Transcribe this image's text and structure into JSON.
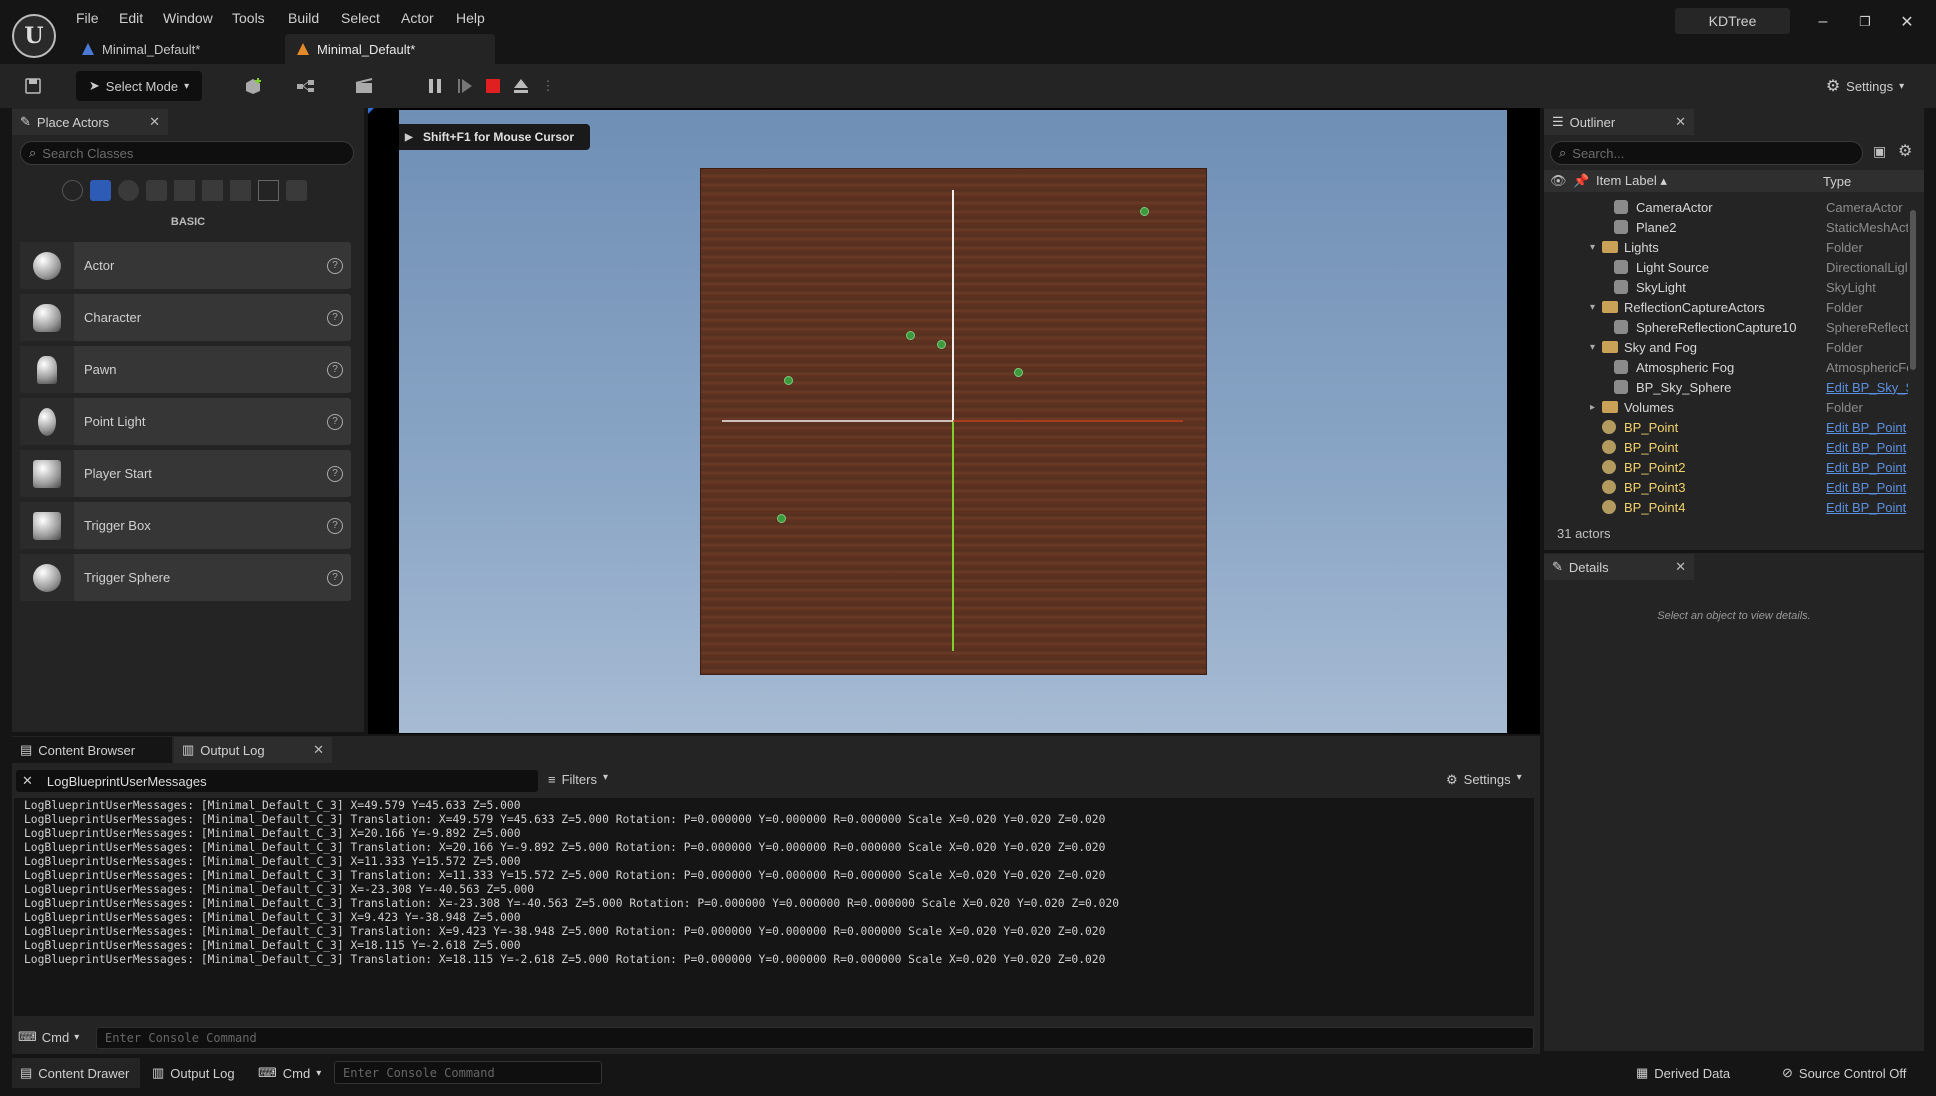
{
  "menu": [
    "File",
    "Edit",
    "Window",
    "Tools",
    "Build",
    "Select",
    "Actor",
    "Help"
  ],
  "project_name": "KDTree",
  "window_buttons": {
    "minimize": "–",
    "restore": "❐",
    "close": "✕"
  },
  "doc_tabs": [
    {
      "label": "Minimal_Default*"
    },
    {
      "label": "Minimal_Default*"
    }
  ],
  "toolbar": {
    "select_mode": "Select Mode",
    "settings": "Settings"
  },
  "place_actors": {
    "tab": "Place Actors",
    "search_placeholder": "Search Classes",
    "category": "BASIC",
    "items": [
      {
        "label": "Actor"
      },
      {
        "label": "Character"
      },
      {
        "label": "Pawn"
      },
      {
        "label": "Point Light"
      },
      {
        "label": "Player Start"
      },
      {
        "label": "Trigger Box"
      },
      {
        "label": "Trigger Sphere"
      }
    ]
  },
  "viewport": {
    "hint": "Shift+F1 for Mouse Cursor",
    "points": [
      {
        "x": 49.579,
        "y": 45.633
      },
      {
        "x": 20.166,
        "y": -9.892
      },
      {
        "x": 11.333,
        "y": 15.572
      },
      {
        "x": -23.308,
        "y": -40.563
      },
      {
        "x": 9.423,
        "y": -38.948
      },
      {
        "x": 18.115,
        "y": -2.618
      }
    ]
  },
  "outliner": {
    "tab": "Outliner",
    "search_placeholder": "Search...",
    "col_label": "Item Label ▴",
    "col_type": "Type",
    "rows": [
      {
        "label": "CameraActor",
        "type": "CameraActor",
        "indent": 2,
        "kind": "gen",
        "link": false
      },
      {
        "label": "Plane2",
        "type": "StaticMeshAct",
        "indent": 2,
        "kind": "gen",
        "link": false
      },
      {
        "label": "Lights",
        "type": "Folder",
        "indent": 1,
        "kind": "folder",
        "link": false
      },
      {
        "label": "Light Source",
        "type": "DirectionalLigl",
        "indent": 2,
        "kind": "gen",
        "link": false
      },
      {
        "label": "SkyLight",
        "type": "SkyLight",
        "indent": 2,
        "kind": "gen",
        "link": false
      },
      {
        "label": "ReflectionCaptureActors",
        "type": "Folder",
        "indent": 1,
        "kind": "folder",
        "link": false
      },
      {
        "label": "SphereReflectionCapture10",
        "type": "SphereReflect",
        "indent": 2,
        "kind": "gen",
        "link": false
      },
      {
        "label": "Sky and Fog",
        "type": "Folder",
        "indent": 1,
        "kind": "folder",
        "link": false
      },
      {
        "label": "Atmospheric Fog",
        "type": "AtmosphericFo",
        "indent": 2,
        "kind": "gen",
        "link": false
      },
      {
        "label": "BP_Sky_Sphere",
        "type": "Edit BP_Sky_S",
        "indent": 2,
        "kind": "gen",
        "link": true
      },
      {
        "label": "Volumes",
        "type": "Folder",
        "indent": 1,
        "kind": "folder",
        "link": false
      },
      {
        "label": "BP_Point",
        "type": "Edit BP_Point",
        "indent": 1,
        "kind": "bp",
        "link": true
      },
      {
        "label": "BP_Point",
        "type": "Edit BP_Point",
        "indent": 1,
        "kind": "bp",
        "link": true
      },
      {
        "label": "BP_Point2",
        "type": "Edit BP_Point",
        "indent": 1,
        "kind": "bp",
        "link": true
      },
      {
        "label": "BP_Point3",
        "type": "Edit BP_Point",
        "indent": 1,
        "kind": "bp",
        "link": true
      },
      {
        "label": "BP_Point4",
        "type": "Edit BP_Point",
        "indent": 1,
        "kind": "bp",
        "link": true
      }
    ],
    "count": "31 actors"
  },
  "details": {
    "tab": "Details",
    "empty": "Select an object to view details."
  },
  "bottom_tabs": {
    "content_browser": "Content Browser",
    "output_log": "Output Log"
  },
  "log": {
    "filter_text": "LogBlueprintUserMessages",
    "filters": "Filters",
    "settings": "Settings",
    "lines": [
      "LogBlueprintUserMessages: [Minimal_Default_C_3] X=49.579 Y=45.633 Z=5.000",
      "LogBlueprintUserMessages: [Minimal_Default_C_3] Translation: X=49.579 Y=45.633 Z=5.000 Rotation: P=0.000000 Y=0.000000 R=0.000000 Scale X=0.020 Y=0.020 Z=0.020",
      "LogBlueprintUserMessages: [Minimal_Default_C_3] X=20.166 Y=-9.892 Z=5.000",
      "LogBlueprintUserMessages: [Minimal_Default_C_3] Translation: X=20.166 Y=-9.892 Z=5.000 Rotation: P=0.000000 Y=0.000000 R=0.000000 Scale X=0.020 Y=0.020 Z=0.020",
      "LogBlueprintUserMessages: [Minimal_Default_C_3] X=11.333 Y=15.572 Z=5.000",
      "LogBlueprintUserMessages: [Minimal_Default_C_3] Translation: X=11.333 Y=15.572 Z=5.000 Rotation: P=0.000000 Y=0.000000 R=0.000000 Scale X=0.020 Y=0.020 Z=0.020",
      "LogBlueprintUserMessages: [Minimal_Default_C_3] X=-23.308 Y=-40.563 Z=5.000",
      "LogBlueprintUserMessages: [Minimal_Default_C_3] Translation: X=-23.308 Y=-40.563 Z=5.000 Rotation: P=0.000000 Y=0.000000 R=0.000000 Scale X=0.020 Y=0.020 Z=0.020",
      "LogBlueprintUserMessages: [Minimal_Default_C_3] X=9.423 Y=-38.948 Z=5.000",
      "LogBlueprintUserMessages: [Minimal_Default_C_3] Translation: X=9.423 Y=-38.948 Z=5.000 Rotation: P=0.000000 Y=0.000000 R=0.000000 Scale X=0.020 Y=0.020 Z=0.020",
      "LogBlueprintUserMessages: [Minimal_Default_C_3] X=18.115 Y=-2.618 Z=5.000",
      "LogBlueprintUserMessages: [Minimal_Default_C_3] Translation: X=18.115 Y=-2.618 Z=5.000 Rotation: P=0.000000 Y=0.000000 R=0.000000 Scale X=0.020 Y=0.020 Z=0.020"
    ],
    "cmd": "Cmd",
    "console_placeholder": "Enter Console Command"
  },
  "statusbar": {
    "content_drawer": "Content Drawer",
    "output_log": "Output Log",
    "cmd": "Cmd",
    "console_placeholder": "Enter Console Command",
    "derived_data": "Derived Data",
    "source_control": "Source Control Off"
  },
  "colors": {
    "accent": "#e48a2a",
    "link": "#5b8fe0",
    "stop": "#e02020",
    "axis_green": "#7fd02a",
    "axis_red": "#c0401e"
  }
}
